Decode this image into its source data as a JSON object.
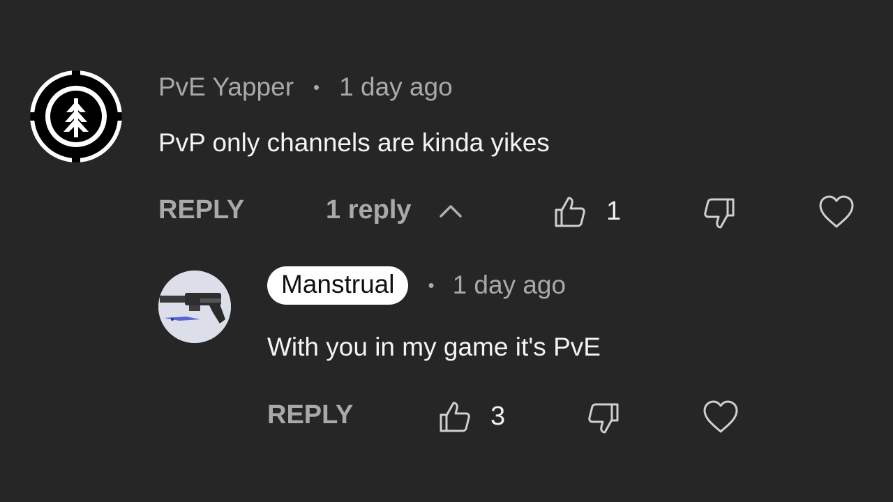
{
  "comment": {
    "author": "PvE Yapper",
    "separator": "•",
    "time": "1 day ago",
    "text": "PvP only channels are kinda yikes",
    "reply_label": "REPLY",
    "replies_label": "1 reply",
    "like_count": "1",
    "icons": {
      "expand": "chevron-up-icon",
      "like": "thumbs-up-icon",
      "dislike": "thumbs-down-icon",
      "heart": "heart-icon"
    }
  },
  "reply": {
    "author": "Manstrual",
    "separator": "•",
    "time": "1 day ago",
    "text": "With you in my game it's PvE",
    "reply_label": "REPLY",
    "like_count": "3",
    "icons": {
      "like": "thumbs-up-icon",
      "dislike": "thumbs-down-icon",
      "heart": "heart-icon"
    }
  },
  "colors": {
    "background": "#262626",
    "muted_text": "#a9a9a9",
    "text": "#f1f1f1",
    "chip": "#ffffff"
  }
}
